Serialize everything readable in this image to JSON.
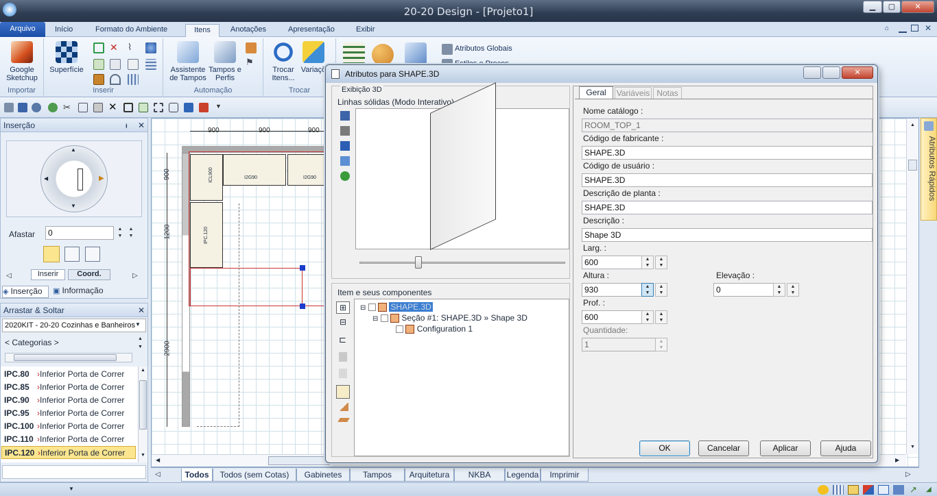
{
  "window": {
    "title": "20-20 Design - [Projeto1]",
    "min": "▁",
    "max": "▢",
    "close": "✕"
  },
  "ribbon": {
    "tabs": [
      {
        "label": "Arquivo"
      },
      {
        "label": "Início"
      },
      {
        "label": "Formato do Ambiente"
      },
      {
        "label": "Itens"
      },
      {
        "label": "Anotações"
      },
      {
        "label": "Apresentação"
      },
      {
        "label": "Exibir"
      }
    ],
    "active_tab": "Itens",
    "groups": {
      "importar": {
        "label": "Importar",
        "google": "Google Sketchup"
      },
      "inserir": {
        "label": "Inserir",
        "superficie": "Superfície"
      },
      "automacao": {
        "label": "Automação",
        "assistente": "Assistente de Tampos",
        "tampos": "Tampos e Perfis"
      },
      "trocar": {
        "label": "Trocar",
        "trocar_itens": "Trocar Itens...",
        "variacoes": "Variaçõ"
      },
      "extra": {
        "atributos": "Atributos Globais",
        "estilos": "Estilos e Preços"
      }
    }
  },
  "insercao": {
    "title": "Inserção",
    "pin": "ᵻ",
    "close": "✕",
    "afastar_label": "Afastar",
    "afastar_value": "0",
    "tab_inserir": "Inserir",
    "tab_coord": "Coord.",
    "tabs2": [
      "Inserção",
      "Informação"
    ]
  },
  "arrastar": {
    "title": "Arrastar & Soltar",
    "catalog": "2020KIT - 20-20 Cozinhas e Banheiros",
    "categorias": "< Categorias >",
    "items": [
      {
        "code": "IPC.80",
        "desc": "Inferior Porta de Correr"
      },
      {
        "code": "IPC.85",
        "desc": "Inferior Porta de Correr"
      },
      {
        "code": "IPC.90",
        "desc": "Inferior Porta de Correr"
      },
      {
        "code": "IPC.95",
        "desc": "Inferior Porta de Correr"
      },
      {
        "code": "IPC.100",
        "desc": "Inferior Porta de Correr"
      },
      {
        "code": "IPC.110",
        "desc": "Inferior Porta de Correr"
      },
      {
        "code": "IPC.120",
        "desc": "Inferior Porta de Correr"
      }
    ],
    "selected": "IPC.120"
  },
  "canvas": {
    "dims_top": [
      "900",
      "900",
      "900"
    ],
    "dims_left": [
      "900",
      "1200",
      "2900"
    ],
    "cabinet_labels": [
      "I2G90",
      "I2G90",
      "ICL900",
      "IPC.120"
    ]
  },
  "bottom_tabs": [
    "Todos",
    "Todos (sem Cotas)",
    "Gabinetes",
    "Tampos",
    "Arquitetura",
    "NKBA",
    "Legenda",
    "Imprimir"
  ],
  "active_bottom_tab": "Todos",
  "side_panel": {
    "label": "Atributos Rápidos"
  },
  "dialog": {
    "title": "Atributos para SHAPE.3D",
    "exibicao": "Exibição 3D",
    "mode": "Linhas sólidas (Modo Interativo)",
    "tree_title": "Item e seus componentes",
    "tree": [
      "SHAPE.3D",
      "Seção #1: SHAPE.3D » Shape 3D",
      "Configuration 1"
    ],
    "tabs": [
      "Geral",
      "Variáveis",
      "Notas"
    ],
    "active_tab": "Geral",
    "fields": {
      "nome_label": "Nome catálogo :",
      "nome": "ROOM_TOP_1",
      "fab_label": "Código de fabricante :",
      "fab": "SHAPE.3D",
      "usuario_label": "Código de usuário :",
      "usuario": "SHAPE.3D",
      "planta_label": "Descrição de planta :",
      "planta": "SHAPE.3D",
      "desc_label": "Descrição :",
      "desc": "Shape 3D",
      "larg_label": "Larg. :",
      "larg": "600",
      "altura_label": "Altura :",
      "altura": "930",
      "elev_label": "Elevação :",
      "elev": "0",
      "prof_label": "Prof. :",
      "prof": "600",
      "qtd_label": "Quantidade:",
      "qtd": "1"
    },
    "buttons": {
      "ok": "OK",
      "cancel": "Cancelar",
      "apply": "Aplicar",
      "help": "Ajuda"
    },
    "slider_value": 0.28
  }
}
